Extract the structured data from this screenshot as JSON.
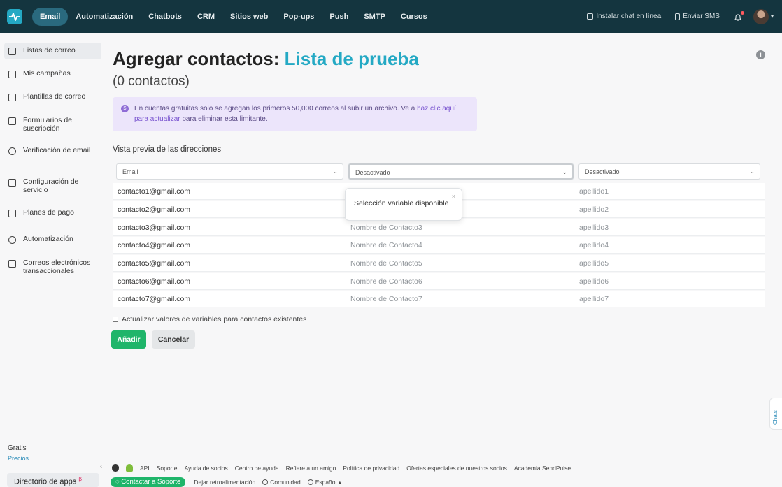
{
  "nav": {
    "items": [
      "Email",
      "Automatización",
      "Chatbots",
      "CRM",
      "Sitios web",
      "Pop-ups",
      "Push",
      "SMTP",
      "Cursos"
    ],
    "install_chat": "Instalar chat en línea",
    "send_sms": "Enviar SMS"
  },
  "sidebar": {
    "items": [
      {
        "label": "Listas de correo"
      },
      {
        "label": "Mis campañas"
      },
      {
        "label": "Plantillas de correo"
      },
      {
        "label": "Formularios de suscripción"
      },
      {
        "label": "Verificación de email"
      },
      {
        "label": "Configuración de servicio"
      },
      {
        "label": "Planes de pago"
      },
      {
        "label": "Automatización"
      },
      {
        "label": "Correos electrónicos transaccionales"
      }
    ],
    "plan": "Gratis",
    "pricing": "Precios",
    "app_directory": "Directorio de apps",
    "beta": "β"
  },
  "page": {
    "title_prefix": "Agregar contactos:",
    "list_name": "Lista de prueba",
    "contact_count": "(0 contactos)",
    "notice_text": "En cuentas gratuitas solo se agregan los primeros 50,000 correos al subir un archivo. Ve a ",
    "notice_link": "haz clic aquí para actualizar",
    "notice_text_end": " para eliminar esta limitante.",
    "preview_label": "Vista previa de las direcciones",
    "columns": [
      "Email",
      "Desactivado",
      "Desactivado"
    ],
    "tooltip": "Selección variable disponible",
    "update_checkbox_label": "Actualizar valores de variables para contactos existentes",
    "add_button": "Añadir",
    "cancel_button": "Cancelar"
  },
  "rows": [
    [
      "contacto1@gmail.com",
      "",
      "apellido1"
    ],
    [
      "contacto2@gmail.com",
      "",
      "apellido2"
    ],
    [
      "contacto3@gmail.com",
      "Nombre de Contacto3",
      "apellido3"
    ],
    [
      "contacto4@gmail.com",
      "Nombre de Contacto4",
      "apellido4"
    ],
    [
      "contacto5@gmail.com",
      "Nombre de Contacto5",
      "apellido5"
    ],
    [
      "contacto6@gmail.com",
      "Nombre de Contacto6",
      "apellido6"
    ],
    [
      "contacto7@gmail.com",
      "Nombre de Contacto7",
      "apellido7"
    ]
  ],
  "footer": {
    "links": [
      "API",
      "Soporte",
      "Ayuda de socios",
      "Centro de ayuda",
      "Refiere a un amigo",
      "Política de privacidad",
      "Ofertas especiales de nuestros socios",
      "Academia SendPulse"
    ],
    "support_button": "Contactar a Soporte",
    "feedback": "Dejar retroalimentación",
    "community": "Comunidad",
    "language": "Español"
  },
  "chats_tab": "Chats",
  "colors": {
    "topbar": "#14353f",
    "accent": "#24a9c4",
    "primary_button": "#1fb56a",
    "notice_bg": "#ece5fb"
  }
}
